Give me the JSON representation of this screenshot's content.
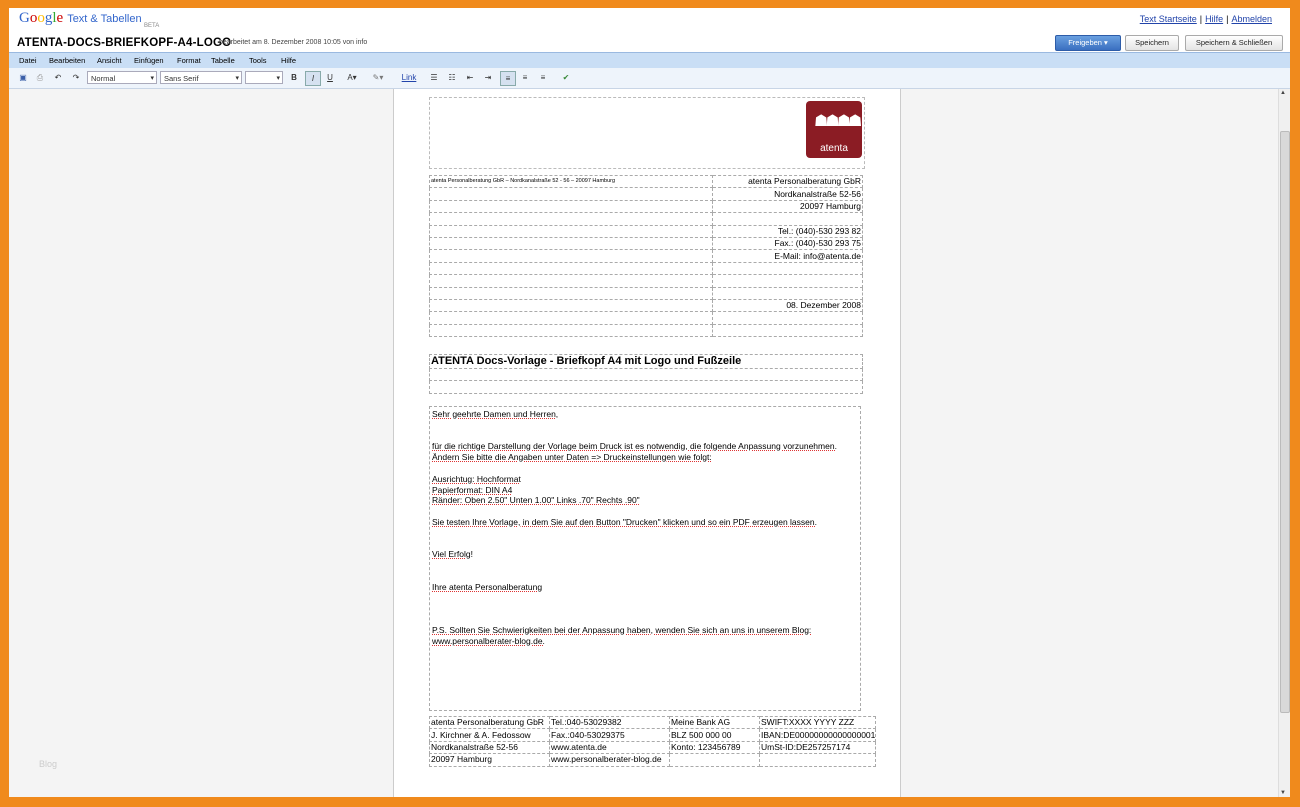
{
  "header": {
    "product": "Text & Tabellen",
    "beta": "BETA",
    "doc_title": "ATENTA-DOCS-BRIEFKOPF-A4-LOGO",
    "edit_info": "bearbeitet am 8. Dezember 2008 10:05 von info",
    "links": {
      "home": "Text Startseite",
      "help": "Hilfe",
      "logout": "Abmelden"
    },
    "buttons": {
      "share": "Freigeben ▾",
      "save": "Speichern",
      "save_close": "Speichern & Schließen"
    }
  },
  "menu": [
    "Datei",
    "Bearbeiten",
    "Ansicht",
    "Einfügen",
    "Format",
    "Tabelle",
    "Tools",
    "Hilfe"
  ],
  "toolbar": {
    "style": "Normal",
    "font": "Sans Serif",
    "size": "",
    "bold": "B",
    "italic": "I",
    "underline": "U",
    "link": "Link"
  },
  "address_rows": [
    [
      "atenta Personalberatung GbR – Nordkanalstraße 52 - 56 – 20097 Hamburg",
      "atenta Personalberatung GbR"
    ],
    [
      "",
      "Nordkanalstraße 52-56"
    ],
    [
      "",
      "20097 Hamburg"
    ],
    [
      "",
      ""
    ],
    [
      "",
      "Tel.: (040)-530 293 82"
    ],
    [
      "",
      "Fax.: (040)-530 293 75"
    ],
    [
      "",
      "E-Mail: info@atenta.de"
    ],
    [
      "",
      ""
    ],
    [
      "",
      ""
    ],
    [
      "",
      ""
    ],
    [
      "",
      "08. Dezember 2008"
    ],
    [
      "",
      ""
    ],
    [
      "",
      ""
    ]
  ],
  "doc_heading": "ATENTA Docs-Vorlage - Briefkopf A4 mit Logo und Fußzeile",
  "logo_text": "atenta",
  "body": {
    "greeting": "Sehr geehrte Damen und Herren,",
    "p1": "für die richtige Darstellung der Vorlage beim Druck ist es notwendig, die folgende Anpassung vorzunehmen. Ändern Sie bitte die Angaben unter Daten => Druckeinstellungen wie folgt:",
    "l1": "Ausrichtug: Hochformat",
    "l2": "Papierformat: DIN A4",
    "l3": "Ränder: Oben 2.50\" Unten 1.00\" Links .70\" Rechts .90\"",
    "p2": "Sie testen Ihre Vorlage, in dem Sie auf den Button \"Drucken\" klicken und so ein PDF erzeugen lassen.",
    "p3": "Viel Erfolg!",
    "p4": "Ihre atenta Personalberatung",
    "ps": "P.S. Sollten Sie Schwierigkeiten bei der Anpassung haben, wenden Sie sich an uns in unserem Blog: www.personalberater-blog.de."
  },
  "footer_rows": [
    [
      "atenta Personalberatung GbR",
      "Tel.:040-53029382",
      "Meine Bank AG",
      "SWIFT:XXXX YYYY ZZZ"
    ],
    [
      "J. Kirchner & A. Fedossow",
      "Fax.:040-53029375",
      "BLZ 500 000 00",
      "IBAN:DE000000000000000010"
    ],
    [
      "Nordkanalstraße 52-56",
      "www.atenta.de",
      "Konto: 123456789",
      "UmSt-ID:DE257257174"
    ],
    [
      "20097 Hamburg",
      "www.personalberater-blog.de",
      "",
      ""
    ]
  ],
  "side_label": "Blog"
}
